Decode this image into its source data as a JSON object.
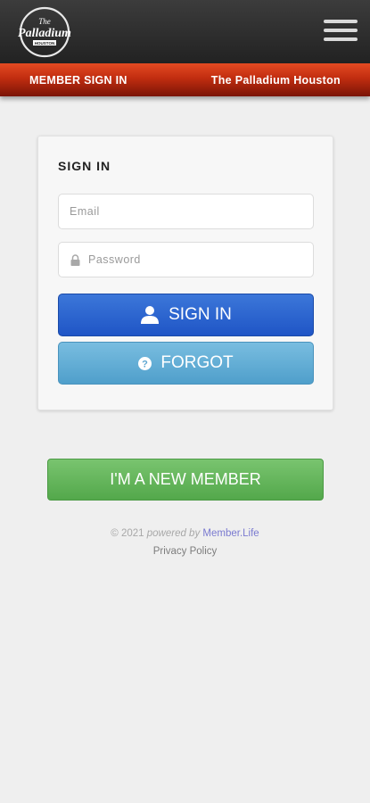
{
  "header": {
    "logo_text_top": "The",
    "logo_text_main": "Palladium",
    "logo_text_sub": "HOUSTON",
    "menu_icon": "hamburger-icon"
  },
  "banner": {
    "left": "MEMBER SIGN IN",
    "right": "The Palladium Houston"
  },
  "signin": {
    "title": "SIGN IN",
    "email_placeholder": "Email",
    "password_placeholder": "Password",
    "signin_label": "SIGN IN",
    "forgot_label": "FORGOT"
  },
  "new_member": {
    "label": "I'M A NEW MEMBER"
  },
  "footer": {
    "copyright": "© 2021",
    "powered_by": "powered by",
    "brand": "Member.Life",
    "privacy": "Privacy Policy"
  },
  "colors": {
    "signin": "#2b62cf",
    "forgot": "#62abd5",
    "new_member": "#66b75d",
    "banner": "#c63312"
  }
}
